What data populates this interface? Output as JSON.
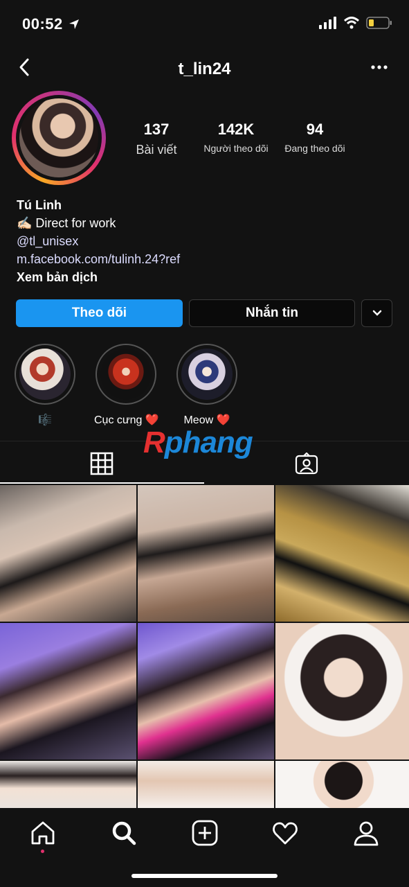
{
  "status_bar": {
    "time": "00:52"
  },
  "header": {
    "username": "t_lin24"
  },
  "stats": [
    {
      "value": "137",
      "label": "Bài viết"
    },
    {
      "value": "142K",
      "label": "Người theo dõi"
    },
    {
      "value": "94",
      "label": "Đang theo dõi"
    }
  ],
  "bio": {
    "name": "Tú Linh",
    "line1": "✍🏻 Direct for work",
    "handle": "@tl_unisex",
    "link": "m.facebook.com/tulinh.24?ref",
    "translate": "Xem bản dịch"
  },
  "buttons": {
    "follow": "Theo dõi",
    "message": "Nhắn tin"
  },
  "highlights": [
    {
      "caption": "🎼"
    },
    {
      "caption": "Cục cưng ❤️"
    },
    {
      "caption": "Meow ❤️"
    }
  ],
  "watermark": {
    "part1": "R",
    "part2": "phang"
  },
  "colors": {
    "accent": "#1a95f0",
    "background": "#121212"
  },
  "icons": [
    "back-icon",
    "more-icon",
    "chevron-down-icon",
    "grid-icon",
    "tagged-icon",
    "home-icon",
    "search-icon",
    "new-post-icon",
    "heart-icon",
    "profile-icon"
  ]
}
